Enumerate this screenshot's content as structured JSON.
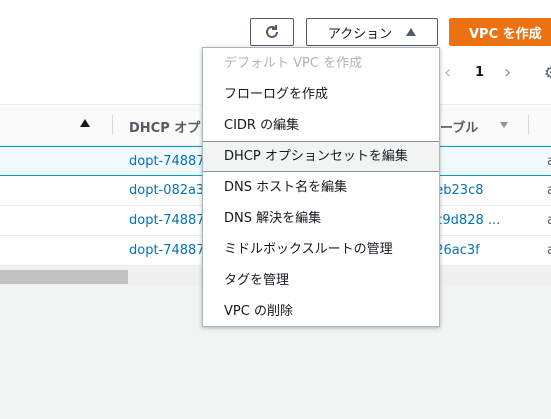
{
  "toolbar": {
    "refresh_icon": "refresh-icon",
    "actions_label": "アクション",
    "create_vpc_label": "VPC を作成"
  },
  "pagination": {
    "current_page": "1",
    "prev_icon": "chevron-left-icon",
    "next_icon": "chevron-right-icon",
    "settings_icon": "gear-icon"
  },
  "table": {
    "columns": {
      "dhcp": "DHCP オプ",
      "route_table": "ーブル"
    },
    "rows": [
      {
        "dhcp": "dopt-74887",
        "route_table": "",
        "extra": "a"
      },
      {
        "dhcp": "dopt-082a3",
        "route_table": "3eb23c8",
        "extra": "a"
      },
      {
        "dhcp": "dopt-74887",
        "route_table": "dc9d828 ...",
        "extra": "a"
      },
      {
        "dhcp": "dopt-74887",
        "route_table": "d26ac3f",
        "extra": "a"
      }
    ]
  },
  "actions_menu": {
    "items": [
      {
        "label": "デフォルト VPC を作成"
      },
      {
        "label": "フローログを作成"
      },
      {
        "label": "CIDR の編集"
      },
      {
        "label": "DHCP オプションセットを編集"
      },
      {
        "label": "DNS ホスト名を編集"
      },
      {
        "label": "DNS 解決を編集"
      },
      {
        "label": "ミドルボックスルートの管理"
      },
      {
        "label": "タグを管理"
      },
      {
        "label": "VPC の削除"
      }
    ]
  },
  "colors": {
    "primary_button": "#ec7211",
    "link": "#0073bb",
    "selected_row_border": "#00a1c9"
  }
}
